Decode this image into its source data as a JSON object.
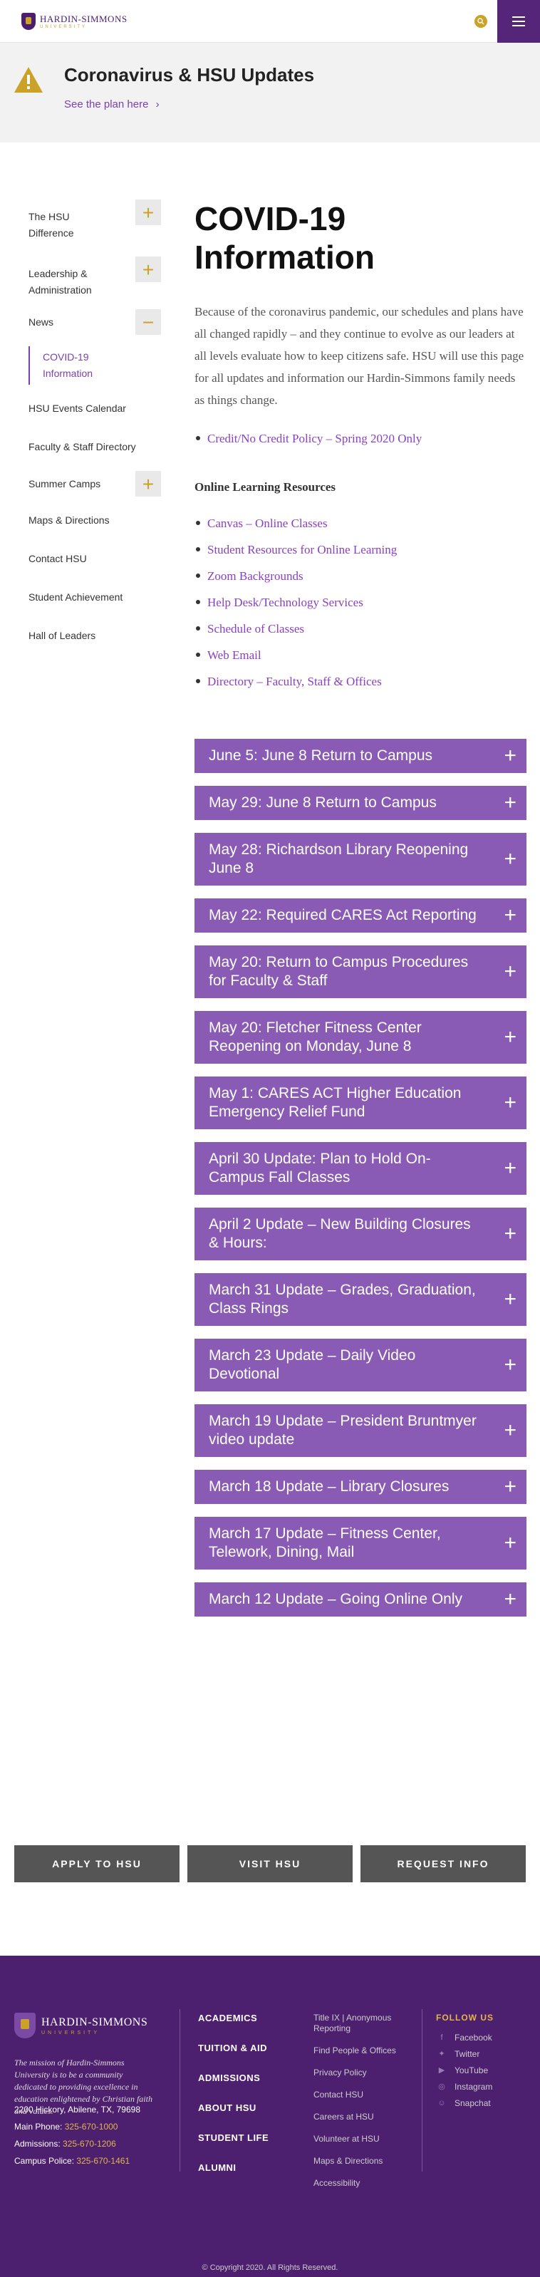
{
  "header": {
    "logo_name": "HARDIN-SIMMONS",
    "logo_sub": "UNIVERSITY",
    "search_icon": "search-icon",
    "menu_icon": "hamburger-icon"
  },
  "alert": {
    "title": "Coronavirus & HSU Updates",
    "link": "See the plan here"
  },
  "sidebar": {
    "items": [
      {
        "label": "The HSU Difference",
        "expand": "+"
      },
      {
        "label": "Leadership & Administration",
        "expand": "+"
      },
      {
        "label": "News",
        "expand": "−"
      },
      {
        "label": "COVID-19 Information"
      },
      {
        "label": "HSU Events Calendar"
      },
      {
        "label": "Faculty & Staff Directory"
      },
      {
        "label": "Summer Camps",
        "expand": "+"
      },
      {
        "label": "Maps & Directions"
      },
      {
        "label": "Contact HSU"
      },
      {
        "label": "Student Achievement"
      },
      {
        "label": "Hall of Leaders"
      }
    ]
  },
  "main": {
    "title": "COVID-19 Information",
    "intro": "Because of the coronavirus pandemic, our schedules and plans have all changed rapidly – and they continue to evolve as our leaders at all levels evaluate how to keep citizens safe. HSU will use this page for all updates and information our Hardin-Simmons family needs as things change.",
    "credit_link": "Credit/No Credit Policy – Spring 2020 Only",
    "resources_heading": "Online Learning Resources",
    "resources": [
      "Canvas – Online Classes",
      "Student Resources for Online Learning",
      "Zoom Backgrounds",
      "Help Desk/Technology Services",
      "Schedule of Classes",
      "Web Email",
      "Directory – Faculty, Staff & Offices"
    ],
    "accordions": [
      "June 5: June 8 Return to Campus",
      "May 29: June 8 Return to Campus",
      "May 28: Richardson Library Reopening June 8",
      "May 22: Required CARES Act Reporting",
      "May 20: Return to Campus Procedures for Faculty & Staff",
      "May 20: Fletcher Fitness Center Reopening on Monday, June 8",
      "May 1: CARES ACT Higher Education Emergency Relief Fund",
      "April 30 Update: Plan to Hold On-Campus Fall Classes",
      "April 2 Update – New Building Closures & Hours:",
      "March 31 Update – Grades, Graduation, Class Rings",
      "March 23 Update – Daily Video Devotional",
      "March 19 Update – President Bruntmyer video update",
      "March 18 Update – Library Closures",
      "March 17 Update – Fitness Center, Telework, Dining, Mail",
      "March 12 Update – Going Online Only"
    ],
    "accordion_plus": "+"
  },
  "cta": {
    "apply": "APPLY TO HSU",
    "visit": "VISIT HSU",
    "request": "REQUEST INFO"
  },
  "footer": {
    "logo_name": "HARDIN-SIMMONS",
    "logo_sub": "UNIVERSITY",
    "mission": "The mission of Hardin-Simmons University is to be a community dedicated to providing excellence in education enlightened by Christian faith and values.",
    "address": "2200 Hickory, Abilene, TX, 79698",
    "main_phone_label": "Main Phone:",
    "main_phone": "325-670-1000",
    "admissions_label": "Admissions:",
    "admissions_phone": "325-670-1206",
    "police_label": "Campus Police:",
    "police_phone": "325-670-1461",
    "main_links": [
      "ACADEMICS",
      "TUITION & AID",
      "ADMISSIONS",
      "ABOUT HSU",
      "STUDENT LIFE",
      "ALUMNI"
    ],
    "secondary_links": [
      "Title IX | Anonymous Reporting",
      "Find People & Offices",
      "Privacy Policy",
      "Contact HSU",
      "Careers at HSU",
      "Volunteer at HSU",
      "Maps & Directions",
      "Accessibility"
    ],
    "follow_title": "FOLLOW US",
    "social": [
      {
        "label": "Facebook",
        "icon": "facebook-icon"
      },
      {
        "label": "Twitter",
        "icon": "twitter-icon"
      },
      {
        "label": "YouTube",
        "icon": "youtube-icon"
      },
      {
        "label": "Instagram",
        "icon": "instagram-icon"
      },
      {
        "label": "Snapchat",
        "icon": "snapchat-icon"
      }
    ],
    "copyright": "© Copyright 2020. All Rights Reserved."
  }
}
